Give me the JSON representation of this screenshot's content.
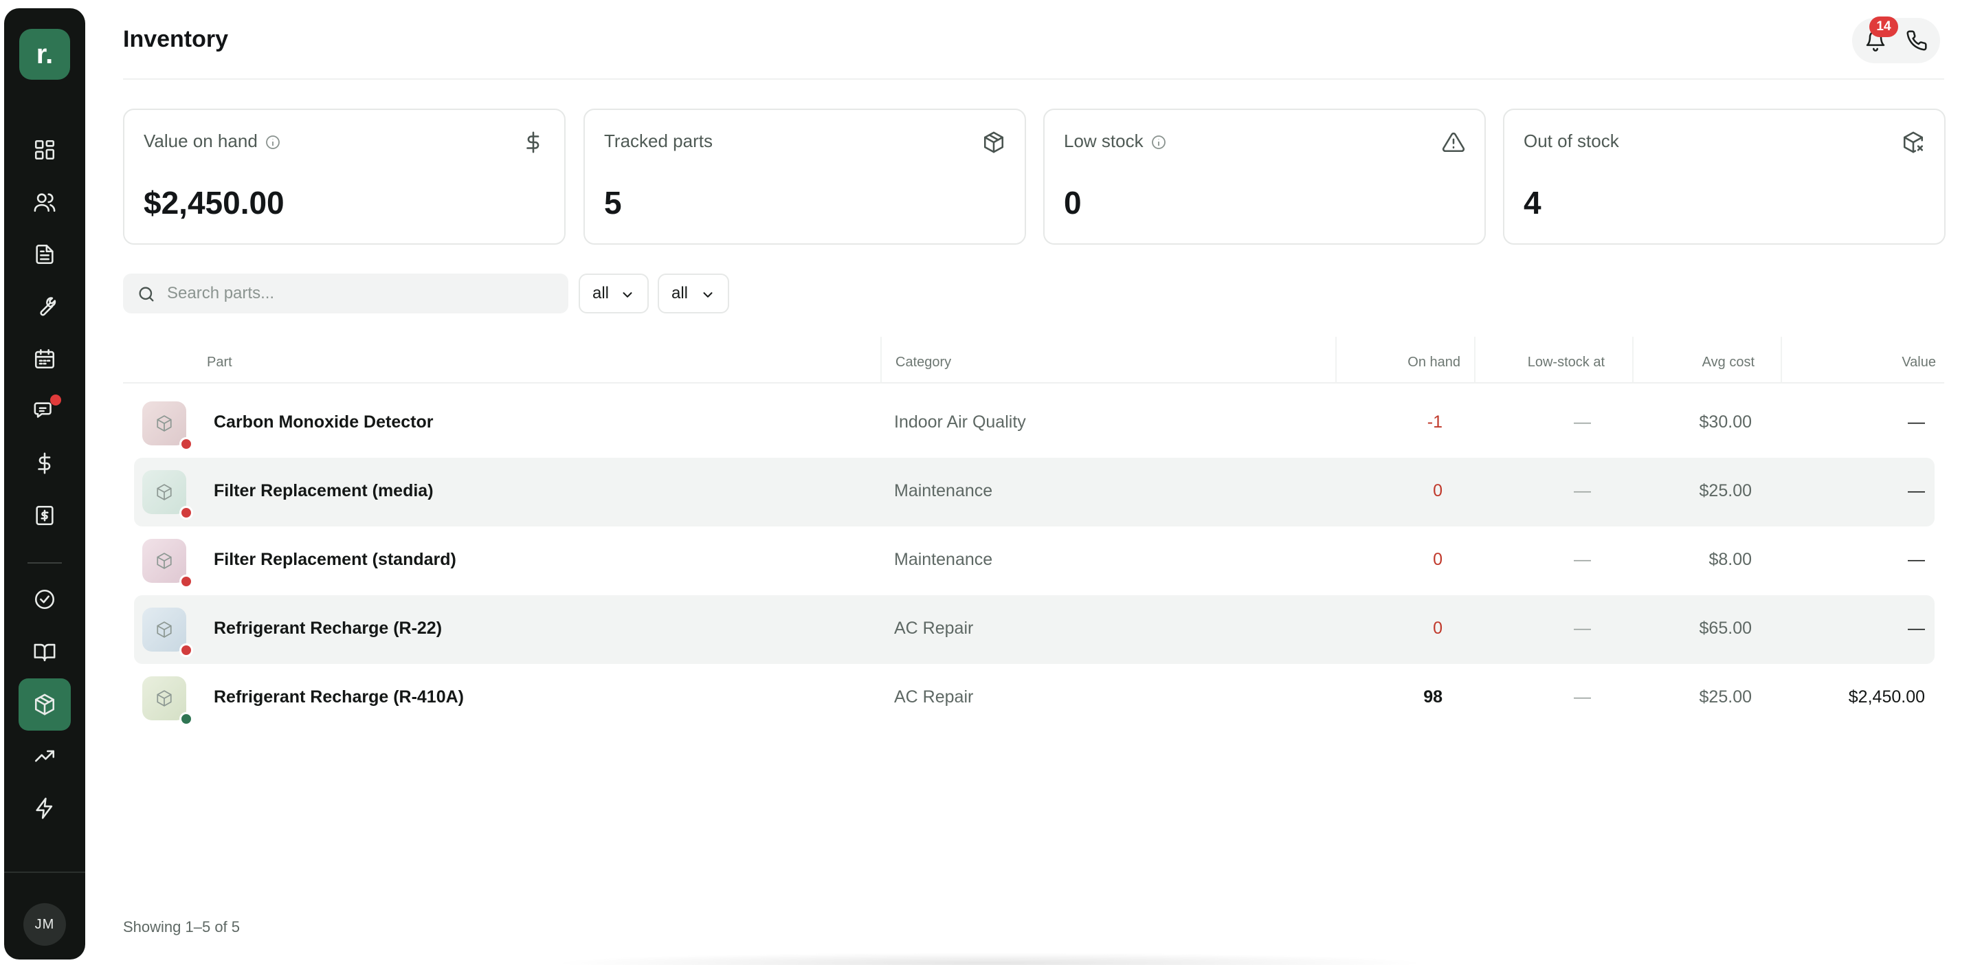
{
  "app": {
    "logo_text": "r.",
    "user_initials": "JM"
  },
  "header": {
    "title": "Inventory",
    "notification_count": "14"
  },
  "stats": [
    {
      "label": "Value on hand",
      "value": "$2,450.00",
      "icon": "dollar-icon",
      "info": true
    },
    {
      "label": "Tracked parts",
      "value": "5",
      "icon": "package-icon",
      "info": false
    },
    {
      "label": "Low stock",
      "value": "0",
      "icon": "warning-triangle-icon",
      "info": true
    },
    {
      "label": "Out of stock",
      "value": "4",
      "icon": "package-x-icon",
      "info": false
    }
  ],
  "toolbar": {
    "search_placeholder": "Search parts...",
    "category_filter": "all",
    "status_filter": "all"
  },
  "table": {
    "headers": {
      "part": "Part",
      "category": "Category",
      "on_hand": "On hand",
      "low_stock_at": "Low-stock at",
      "avg_cost": "Avg cost",
      "value": "Value"
    },
    "rows": [
      {
        "name": "Carbon Monoxide Detector",
        "category": "Indoor Air Quality",
        "on_hand": "-1",
        "low_stock_at": "—",
        "avg_cost": "$30.00",
        "value": "—",
        "status": "out"
      },
      {
        "name": "Filter Replacement (media)",
        "category": "Maintenance",
        "on_hand": "0",
        "low_stock_at": "—",
        "avg_cost": "$25.00",
        "value": "—",
        "status": "out"
      },
      {
        "name": "Filter Replacement (standard)",
        "category": "Maintenance",
        "on_hand": "0",
        "low_stock_at": "—",
        "avg_cost": "$8.00",
        "value": "—",
        "status": "out"
      },
      {
        "name": "Refrigerant Recharge (R-22)",
        "category": "AC Repair",
        "on_hand": "0",
        "low_stock_at": "—",
        "avg_cost": "$65.00",
        "value": "—",
        "status": "out"
      },
      {
        "name": "Refrigerant Recharge (R-410A)",
        "category": "AC Repair",
        "on_hand": "98",
        "low_stock_at": "—",
        "avg_cost": "$25.00",
        "value": "$2,450.00",
        "status": "ok"
      }
    ]
  },
  "footer": {
    "showing": "Showing 1–5 of 5"
  },
  "colors": {
    "brand": "#2f7553",
    "danger": "#c0392b",
    "ok": "#2f7553",
    "sidebar_bg": "#121513"
  }
}
